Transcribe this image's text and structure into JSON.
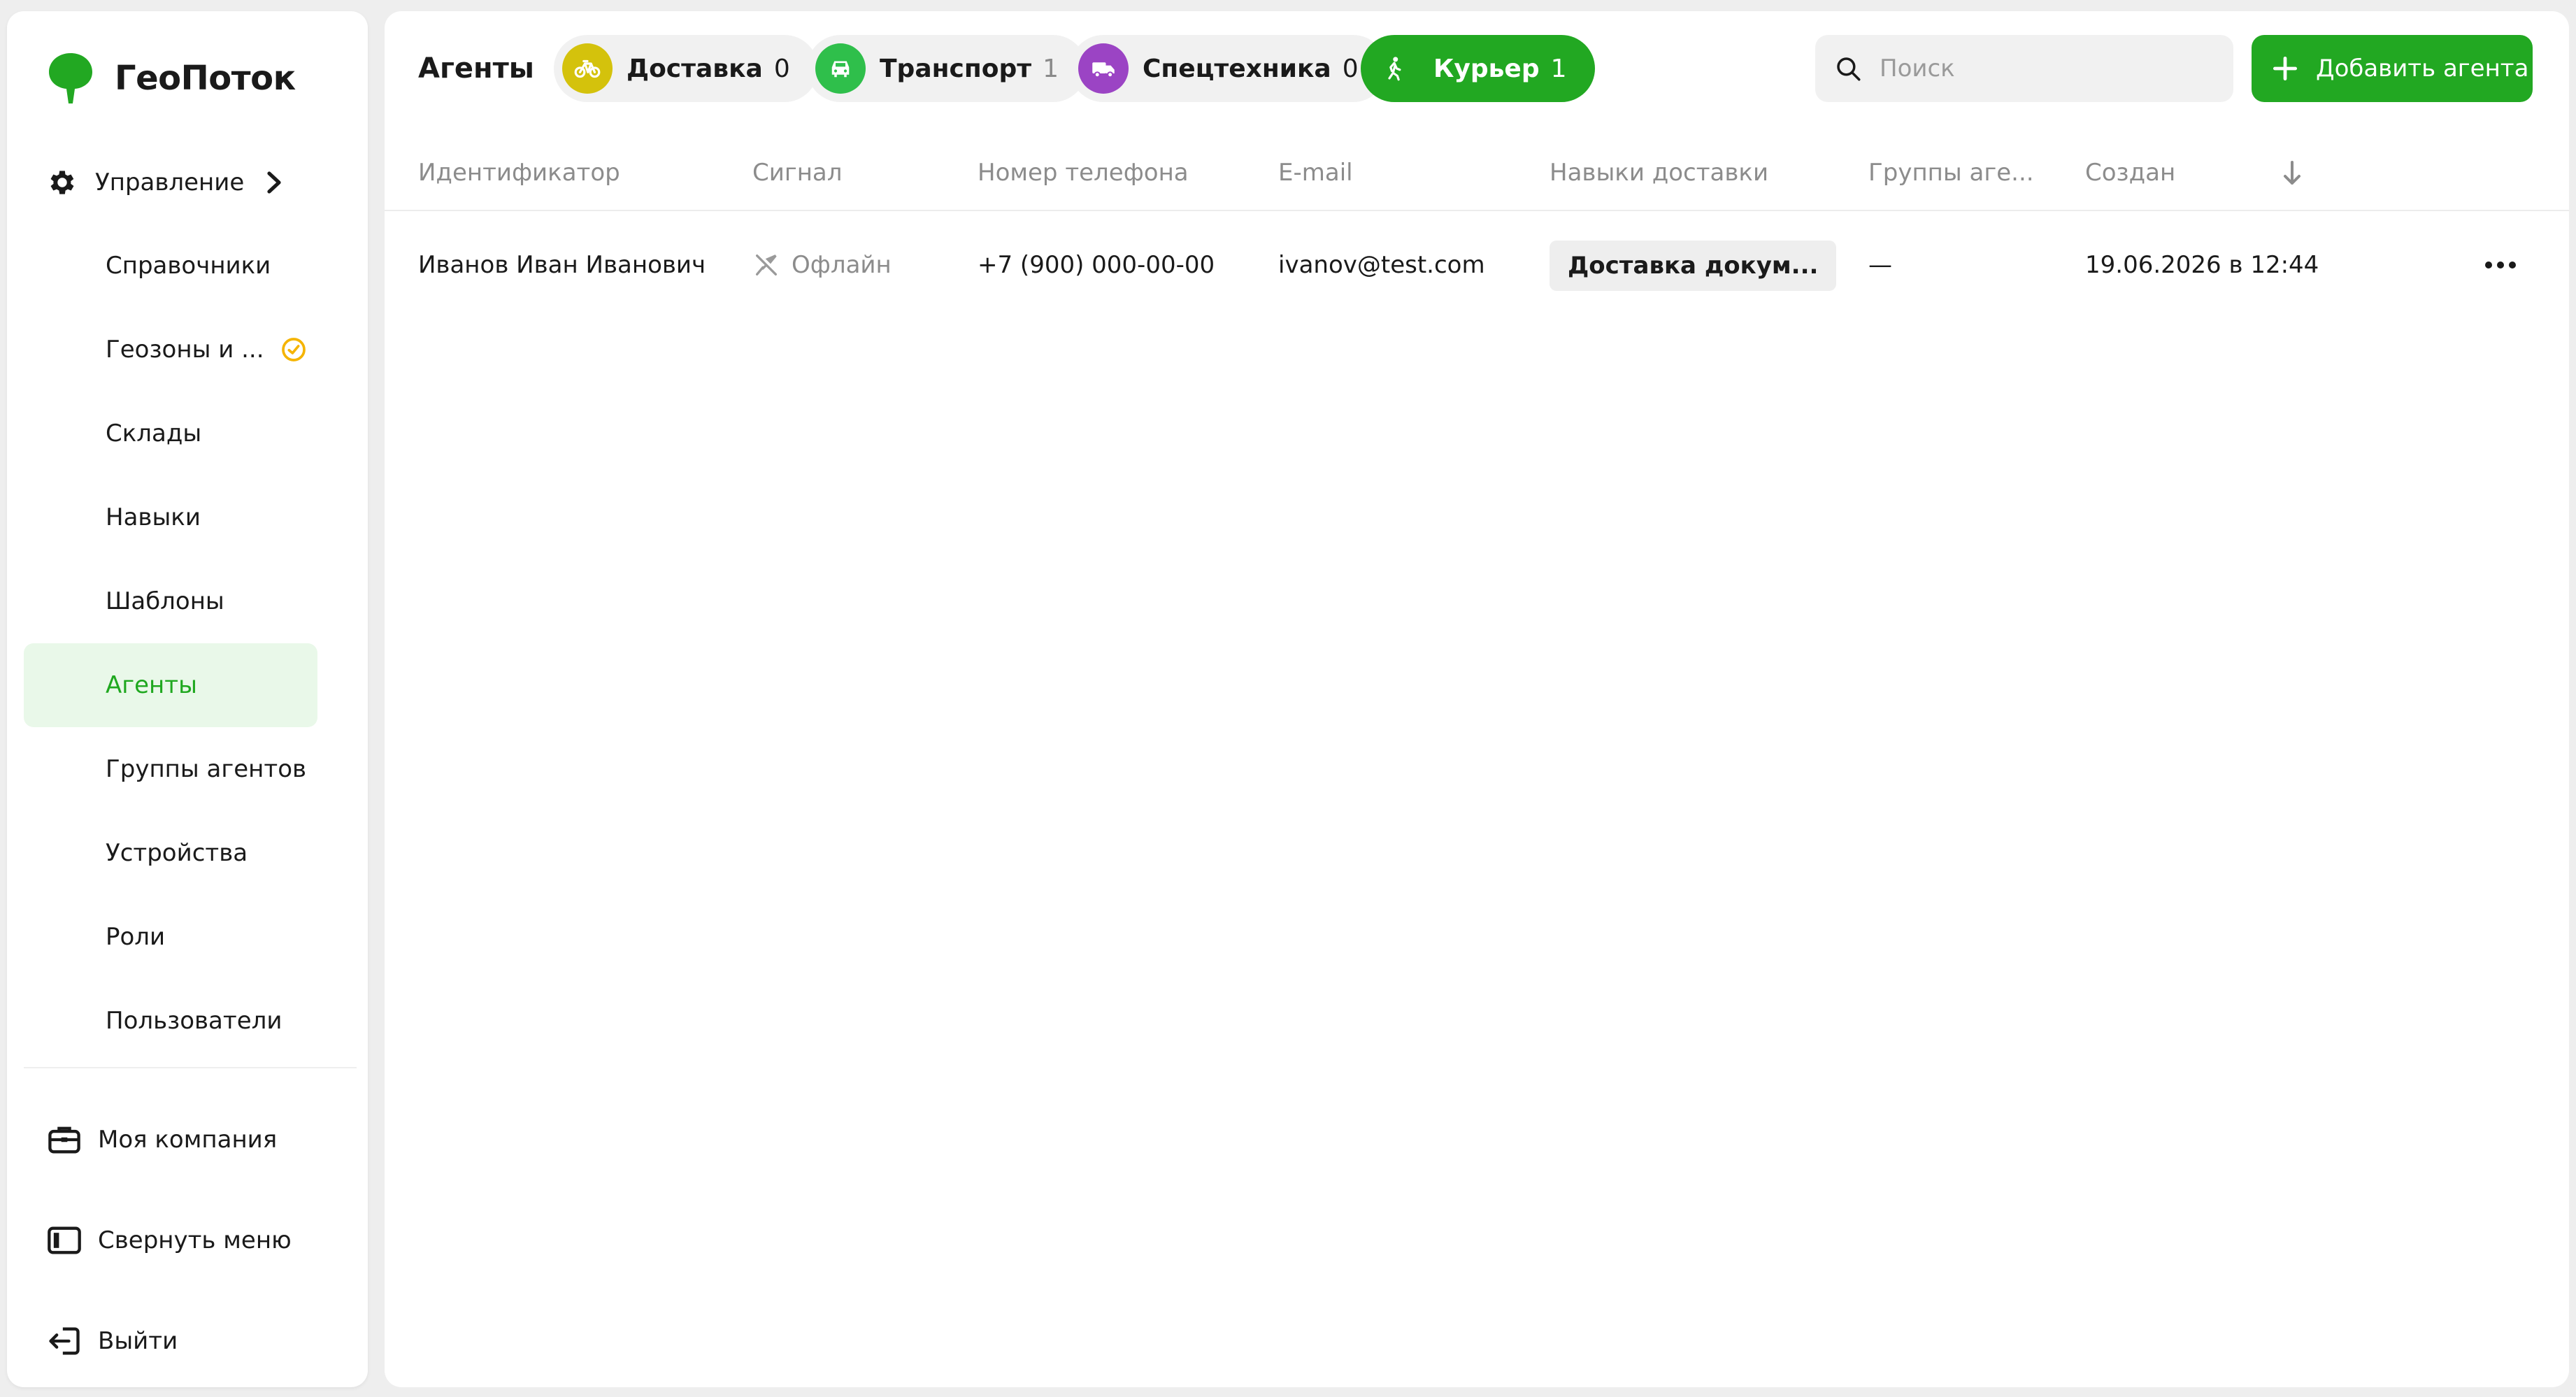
{
  "brand": {
    "name": "ГеоПоток",
    "logo_color": "#22a822"
  },
  "sidebar": {
    "parent": {
      "label": "Управление",
      "icon": "gear-icon"
    },
    "items": [
      {
        "label": "Справочники"
      },
      {
        "label": "Геозоны и ...",
        "warning_icon": "clock-warning-icon"
      },
      {
        "label": "Склады"
      },
      {
        "label": "Навыки"
      },
      {
        "label": "Шаблоны"
      },
      {
        "label": "Агенты",
        "active": true
      },
      {
        "label": "Группы агентов"
      },
      {
        "label": "Устройства"
      },
      {
        "label": "Роли"
      },
      {
        "label": "Пользователи"
      }
    ],
    "bottom": [
      {
        "label": "Моя компания",
        "icon": "briefcase-icon"
      },
      {
        "label": "Свернуть меню",
        "icon": "collapse-sidebar-icon"
      },
      {
        "label": "Выйти",
        "icon": "logout-icon"
      }
    ]
  },
  "header": {
    "title": "Агенты",
    "chips": [
      {
        "label": "Доставка",
        "count": "0",
        "icon": "bicycle-icon",
        "color": "#d4c20c"
      },
      {
        "label": "Транспорт",
        "count": "1",
        "icon": "car-icon",
        "color": "#2fbf4b"
      },
      {
        "label": "Спецтехника",
        "count": "0",
        "icon": "truck-icon",
        "color": "#9b44c4"
      },
      {
        "label": "Курьер",
        "count": "1",
        "icon": "walking-person-icon",
        "color": "#22a822",
        "active": true
      }
    ],
    "search": {
      "placeholder": "Поиск",
      "value": ""
    },
    "add_button": {
      "label": "Добавить агента"
    }
  },
  "table": {
    "columns": [
      "Идентификатор",
      "Сигнал",
      "Номер телефона",
      "E-mail",
      "Навыки доставки",
      "Группы аге...",
      "Создан"
    ],
    "sort": "desc",
    "rows": [
      {
        "id": "Иванов Иван Иванович",
        "signal": "Офлайн",
        "phone": "+7 (900) 000-00-00",
        "email": "ivanov@test.com",
        "skills": "Доставка докум...",
        "groups": "—",
        "created": "19.06.2026 в 12:44"
      }
    ]
  },
  "colors": {
    "accent": "#22a822",
    "active_bg": "#e9f8e9",
    "warning": "#f5b400",
    "muted_text": "#8c8c8c"
  }
}
